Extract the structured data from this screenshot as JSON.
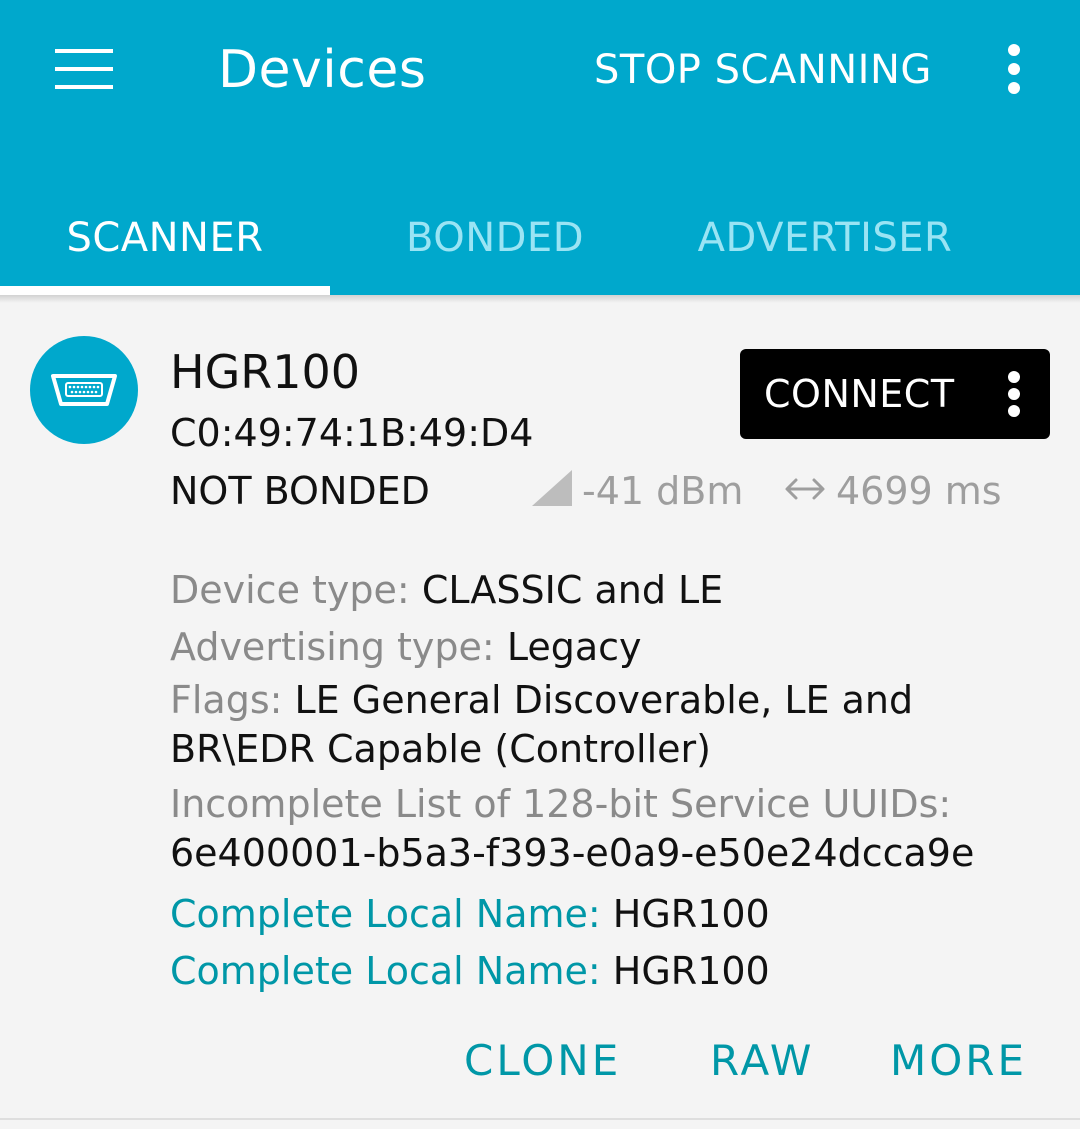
{
  "appbar": {
    "title": "Devices",
    "action_label": "STOP SCANNING",
    "background_color": "#00a8cc",
    "icons": {
      "menu": "hamburger-menu-icon",
      "overflow": "more-vertical-icon"
    }
  },
  "tabs": [
    {
      "label": "SCANNER",
      "selected": true
    },
    {
      "label": "BONDED",
      "selected": false
    },
    {
      "label": "ADVERTISER",
      "selected": false
    }
  ],
  "device": {
    "icon": "serial-port-icon",
    "name": "HGR100",
    "address": "C0:49:74:1B:49:D4",
    "bond_state": "NOT BONDED",
    "rssi": "-41 dBm",
    "interval": "4699 ms",
    "connect_label": "CONNECT",
    "details": {
      "device_type_label": "Device type: ",
      "device_type_value": "CLASSIC and LE",
      "adv_type_label": "Advertising type: ",
      "adv_type_value": "Legacy",
      "flags_label": "Flags: ",
      "flags_value": "LE General Discoverable, LE and BR\\EDR Capable (Controller)",
      "uuids_label": "Incomplete List of 128-bit Service UUIDs:",
      "uuids_value": "6e400001-b5a3-f393-e0a9-e50e24dcca9e",
      "local_names": [
        {
          "label": "Complete Local Name: ",
          "value": "HGR100"
        },
        {
          "label": "Complete Local Name: ",
          "value": "HGR100"
        }
      ]
    },
    "actions": {
      "clone": "CLONE",
      "raw": "RAW",
      "more": "MORE"
    }
  },
  "colors": {
    "accent": "#0097a7",
    "label_gray": "#8a8a8a",
    "connect_button": "#000000"
  }
}
